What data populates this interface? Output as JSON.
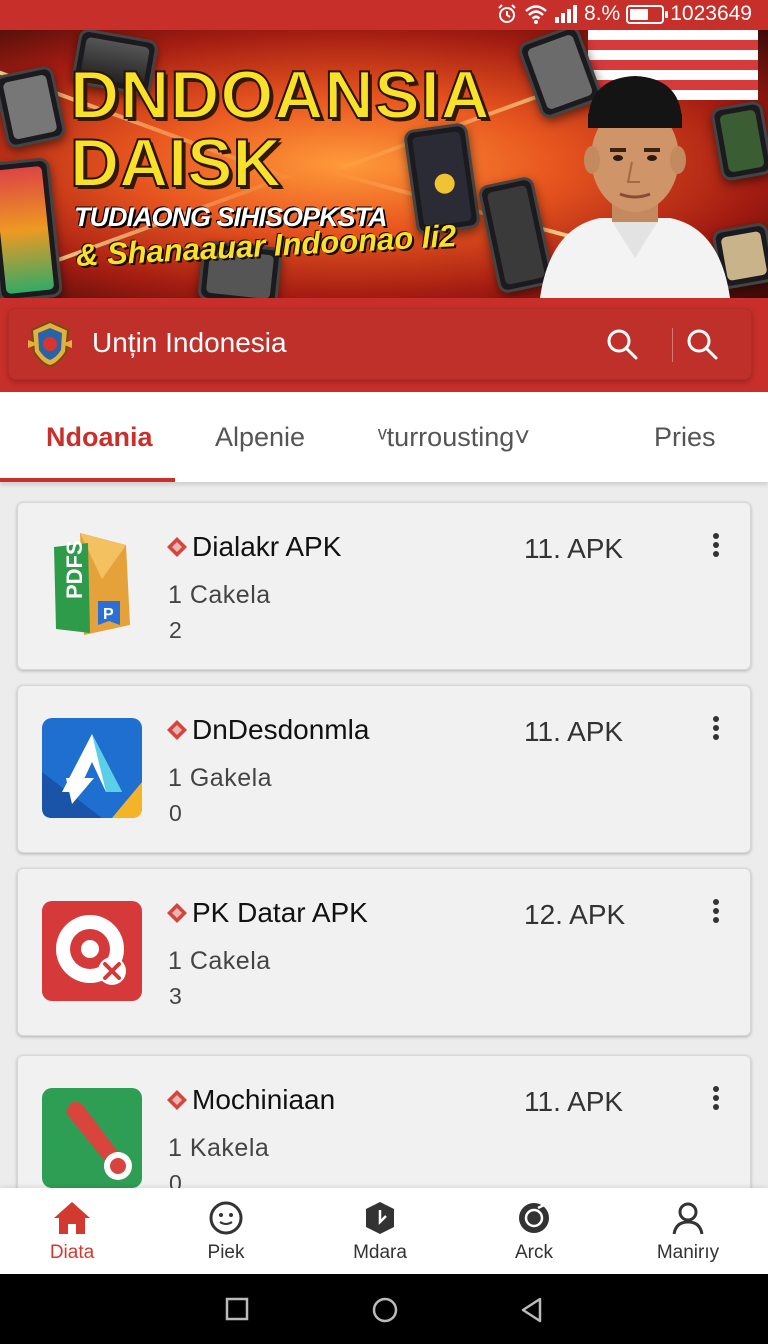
{
  "status_bar": {
    "battery_text": "8.%",
    "battery_level": 0.65,
    "time": "1023649",
    "icons": [
      "alarm-icon",
      "wifi-icon",
      "signal-icon",
      "battery-icon"
    ]
  },
  "banner": {
    "line1": "DNDOANSIA",
    "line2": "DAISK",
    "line3": "TUDIAONG SIHISOPKSTA",
    "line4": "& Shanaauar Indoonao Ii2"
  },
  "app_bar": {
    "title": "Unțin Indonesia",
    "icons": [
      "emblem-logo",
      "search-icon",
      "search-icon"
    ]
  },
  "tabs": [
    {
      "label": "Ndoania",
      "active": true
    },
    {
      "label": "Alpenie",
      "active": false
    },
    {
      "label": "ᵛturrousting˅",
      "active": false
    },
    {
      "label": "Pries",
      "active": false
    }
  ],
  "apps": [
    {
      "title": "Dialakr APK",
      "version": "11. APK",
      "subtitle": "1  Cakela",
      "count": "2",
      "icon": "pdf-document-icon"
    },
    {
      "title": "DnDesdonmla",
      "version": "11. APK",
      "subtitle": "1  Gakela",
      "count": "0",
      "icon": "arrow-a-icon"
    },
    {
      "title": "PK Datar APK",
      "version": "12. APK",
      "subtitle": "1  Cakela",
      "count": "3",
      "icon": "target-icon"
    },
    {
      "title": "Mochiniaan",
      "version": "11. APK",
      "subtitle": "1  Kakela",
      "count": "0",
      "icon": "pin-icon"
    }
  ],
  "bottom_nav": [
    {
      "label": "Diata",
      "icon": "home-icon",
      "active": true
    },
    {
      "label": "Piek",
      "icon": "smile-icon",
      "active": false
    },
    {
      "label": "Mdara",
      "icon": "box-icon",
      "active": false
    },
    {
      "label": "Arck",
      "icon": "disc-icon",
      "active": false
    },
    {
      "label": "Manirıy",
      "icon": "profile-icon",
      "active": false
    }
  ],
  "colors": {
    "primary_red": "#c62f2a",
    "accent_red": "#c9302c",
    "banner_yellow": "#f7e12b"
  }
}
